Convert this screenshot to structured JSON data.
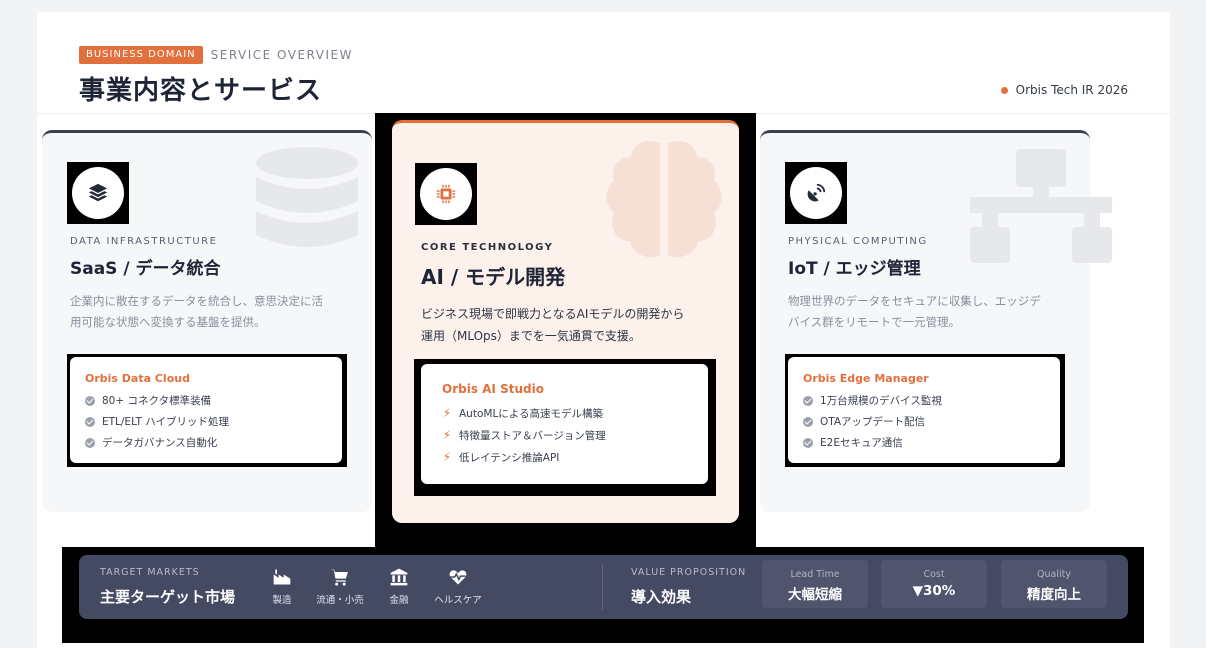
{
  "header": {
    "tag": "BUSINESS DOMAIN",
    "subtag": "SERVICE OVERVIEW",
    "title": "事業内容とサービス",
    "brand": "Orbis Tech IR 2026",
    "accent_color": "#e2703d"
  },
  "cards": [
    {
      "icon": "layers-icon",
      "bg_icon": "database-icon",
      "eyebrow": "DATA INFRASTRUCTURE",
      "title": "SaaS / データ統合",
      "desc_lines": [
        "企業内に散在するデータを統合し、意思決定に活",
        "用可能な状態へ変換する基盤を提供。"
      ],
      "product": "Orbis Data Cloud",
      "features": [
        "80+ コネクタ標準装備",
        "ETL/ELT ハイブリッド処理",
        "データガバナンス自動化"
      ]
    },
    {
      "icon": "cpu-chip-icon",
      "bg_icon": "brain-icon",
      "eyebrow": "CORE TECHNOLOGY",
      "title": "AI / モデル開発",
      "desc_lines": [
        "ビジネス現場で即戦力となるAIモデルの開発から",
        "運用（MLOps）までを一気通貫で支援。"
      ],
      "product": "Orbis AI Studio",
      "features": [
        "AutoMLによる高速モデル構築",
        "特徴量ストア＆バージョン管理",
        "低レイテンシ推論API"
      ]
    },
    {
      "icon": "satellite-dish-icon",
      "bg_icon": "network-icon",
      "eyebrow": "PHYSICAL COMPUTING",
      "title": "IoT / エッジ管理",
      "desc_lines": [
        "物理世界のデータをセキュアに収集し、エッジデ",
        "バイス群をリモートで一元管理。"
      ],
      "product": "Orbis Edge Manager",
      "features": [
        "1万台規模のデバイス監視",
        "OTAアップデート配信",
        "E2Eセキュア通信"
      ]
    }
  ],
  "bottom": {
    "markets_label": "TARGET MARKETS",
    "markets_title": "主要ターゲット市場",
    "markets": [
      {
        "icon": "industry-icon",
        "label": "製造"
      },
      {
        "icon": "cart-icon",
        "label": "流通・小売"
      },
      {
        "icon": "bank-icon",
        "label": "金融"
      },
      {
        "icon": "heartbeat-icon",
        "label": "ヘルスケア"
      }
    ],
    "value_label": "VALUE PROPOSITION",
    "value_title": "導入効果",
    "metrics": [
      {
        "label": "Lead Time",
        "value": "大幅短縮"
      },
      {
        "label": "Cost",
        "value": "▼30%"
      },
      {
        "label": "Quality",
        "value": "精度向上"
      }
    ]
  }
}
